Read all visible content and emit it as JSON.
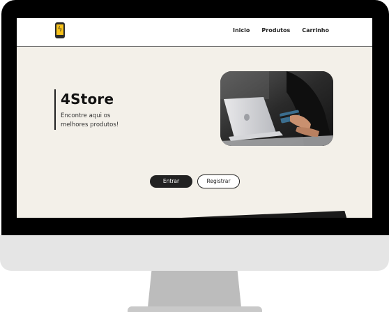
{
  "navbar": {
    "logo_icon": "phone-bolt-icon",
    "links": [
      "Inicio",
      "Produtos",
      "Carrinho"
    ]
  },
  "hero": {
    "title": "4Store",
    "subtitle": "Encontre aqui os melhores produtos!",
    "image_icon": "laptop-credit-card-photo"
  },
  "actions": {
    "enter_label": "Entrar",
    "register_label": "Registrar"
  },
  "colors": {
    "page_background": "#f3f0e9",
    "accent_dark": "#222222",
    "logo_accent": "#f7c21a"
  }
}
